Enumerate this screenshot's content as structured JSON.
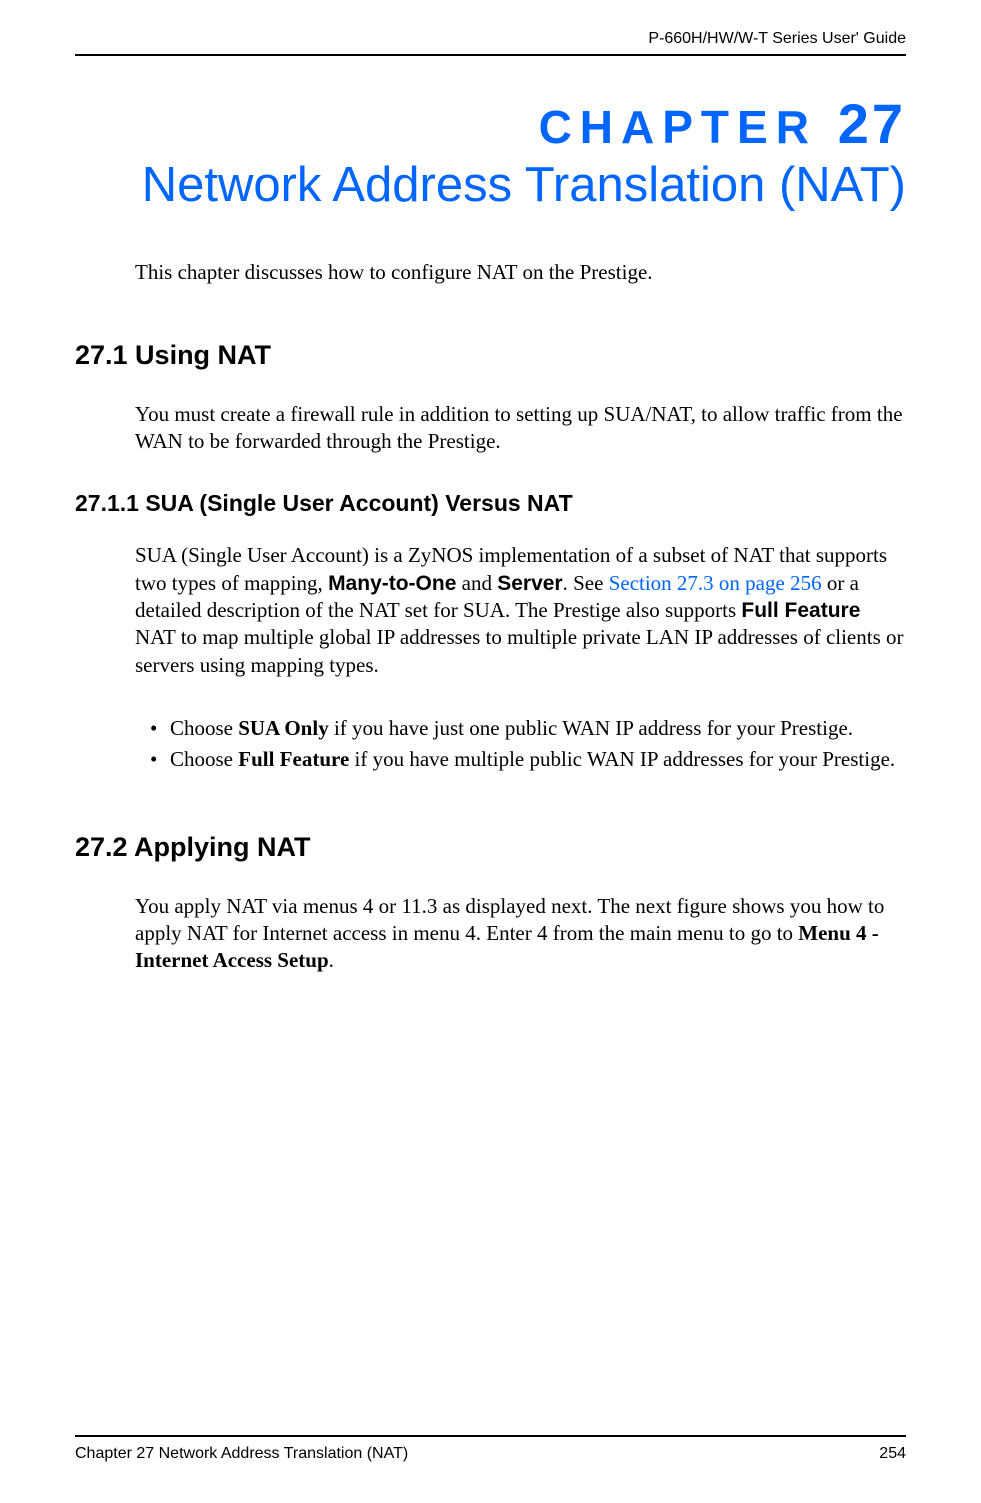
{
  "header": {
    "guide_title": "P-660H/HW/W-T Series User' Guide"
  },
  "chapter": {
    "label_prefix": "CHAPTER",
    "number": "27",
    "title": "Network Address Translation (NAT)",
    "intro": "This chapter discusses how to configure NAT on the Prestige."
  },
  "section_27_1": {
    "heading": "27.1  Using NAT",
    "body": "You must create a firewall rule in addition to setting up SUA/NAT, to allow traffic from the WAN to be forwarded through the Prestige."
  },
  "section_27_1_1": {
    "heading": "27.1.1  SUA (Single User Account) Versus NAT",
    "body_part1": "SUA (Single User Account) is a ZyNOS implementation of a subset of NAT that supports two types of mapping, ",
    "bold1": "Many-to-One",
    "body_part2": " and ",
    "bold2": "Server",
    "body_part3": ". See ",
    "link": "Section 27.3 on page 256",
    "body_part4": " or a detailed description of the NAT set for SUA. The Prestige also supports ",
    "bold3": "Full Feature",
    "body_part5": " NAT to map multiple global IP addresses to multiple private LAN IP addresses of clients or servers using mapping types.",
    "bullet1_pre": "Choose ",
    "bullet1_bold": "SUA Only",
    "bullet1_post": " if you have just one public WAN IP address for your Prestige.",
    "bullet2_pre": "Choose ",
    "bullet2_bold": "Full Feature",
    "bullet2_post": " if you have multiple public WAN IP addresses for your Prestige."
  },
  "section_27_2": {
    "heading": "27.2  Applying NAT",
    "body_part1": "You apply NAT via menus 4 or 11.3 as displayed next. The next figure shows you how to apply NAT for Internet access in menu 4. Enter 4 from the main menu to go to ",
    "bold1": "Menu 4 - Internet Access Setup",
    "body_part2": "."
  },
  "footer": {
    "chapter_ref": "Chapter 27 Network Address Translation (NAT)",
    "page_number": "254"
  }
}
